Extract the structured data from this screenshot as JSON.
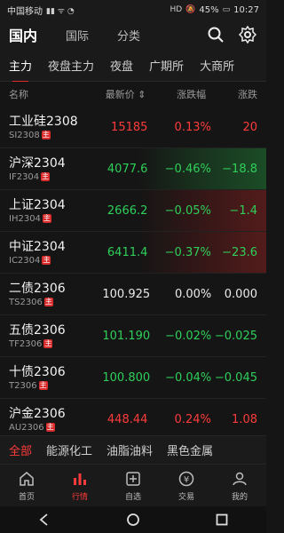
{
  "status": {
    "carrier": "中国移动",
    "battery_pct": "45%",
    "time": "10:27",
    "hd": "HD"
  },
  "topnav": {
    "tabs": [
      {
        "label": "国内",
        "active": true
      },
      {
        "label": "国际",
        "active": false
      },
      {
        "label": "分类",
        "active": false
      }
    ]
  },
  "subtabs": [
    {
      "label": "主力",
      "active": true
    },
    {
      "label": "夜盘主力",
      "active": false
    },
    {
      "label": "夜盘",
      "active": false
    },
    {
      "label": "广期所",
      "active": false
    },
    {
      "label": "大商所",
      "active": false
    }
  ],
  "columns": {
    "name": "名称",
    "price": "最新价",
    "change_pct": "涨跌幅",
    "change": "涨跌",
    "sort_indicator": "⇕"
  },
  "rows": [
    {
      "name": "工业硅2308",
      "code": "SI2308",
      "badge": "主",
      "price": "15185",
      "change_pct": "0.13%",
      "change": "20",
      "trend": "up"
    },
    {
      "name": "沪深2304",
      "code": "IF2304",
      "badge": "主",
      "price": "4077.6",
      "change_pct": "−0.46%",
      "change": "−18.8",
      "trend": "down"
    },
    {
      "name": "上证2304",
      "code": "IH2304",
      "badge": "主",
      "price": "2666.2",
      "change_pct": "−0.05%",
      "change": "−1.4",
      "trend": "down"
    },
    {
      "name": "中证2304",
      "code": "IC2304",
      "badge": "主",
      "price": "6411.4",
      "change_pct": "−0.37%",
      "change": "−23.6",
      "trend": "down"
    },
    {
      "name": "二债2306",
      "code": "TS2306",
      "badge": "主",
      "price": "100.925",
      "change_pct": "0.00%",
      "change": "0.000",
      "trend": "flat"
    },
    {
      "name": "五债2306",
      "code": "TF2306",
      "badge": "主",
      "price": "101.190",
      "change_pct": "−0.02%",
      "change": "−0.025",
      "trend": "down"
    },
    {
      "name": "十债2306",
      "code": "T2306",
      "badge": "主",
      "price": "100.800",
      "change_pct": "−0.04%",
      "change": "−0.045",
      "trend": "down"
    },
    {
      "name": "沪金2306",
      "code": "AU2306",
      "badge": "主",
      "price": "448.44",
      "change_pct": "0.24%",
      "change": "1.08",
      "trend": "up"
    }
  ],
  "categories": [
    {
      "label": "全部",
      "active": true
    },
    {
      "label": "能源化工",
      "active": false
    },
    {
      "label": "油脂油料",
      "active": false
    },
    {
      "label": "黑色金属",
      "active": false
    }
  ],
  "tabbar": [
    {
      "label": "首页",
      "icon": "home-icon",
      "active": false
    },
    {
      "label": "行情",
      "icon": "chart-icon",
      "active": true
    },
    {
      "label": "自选",
      "icon": "watchlist-icon",
      "active": false
    },
    {
      "label": "交易",
      "icon": "trade-icon",
      "active": false
    },
    {
      "label": "我的",
      "icon": "profile-icon",
      "active": false
    }
  ],
  "colors": {
    "up": "#ff3b3b",
    "down": "#2fcf5a",
    "accent": "#e02b2b"
  }
}
